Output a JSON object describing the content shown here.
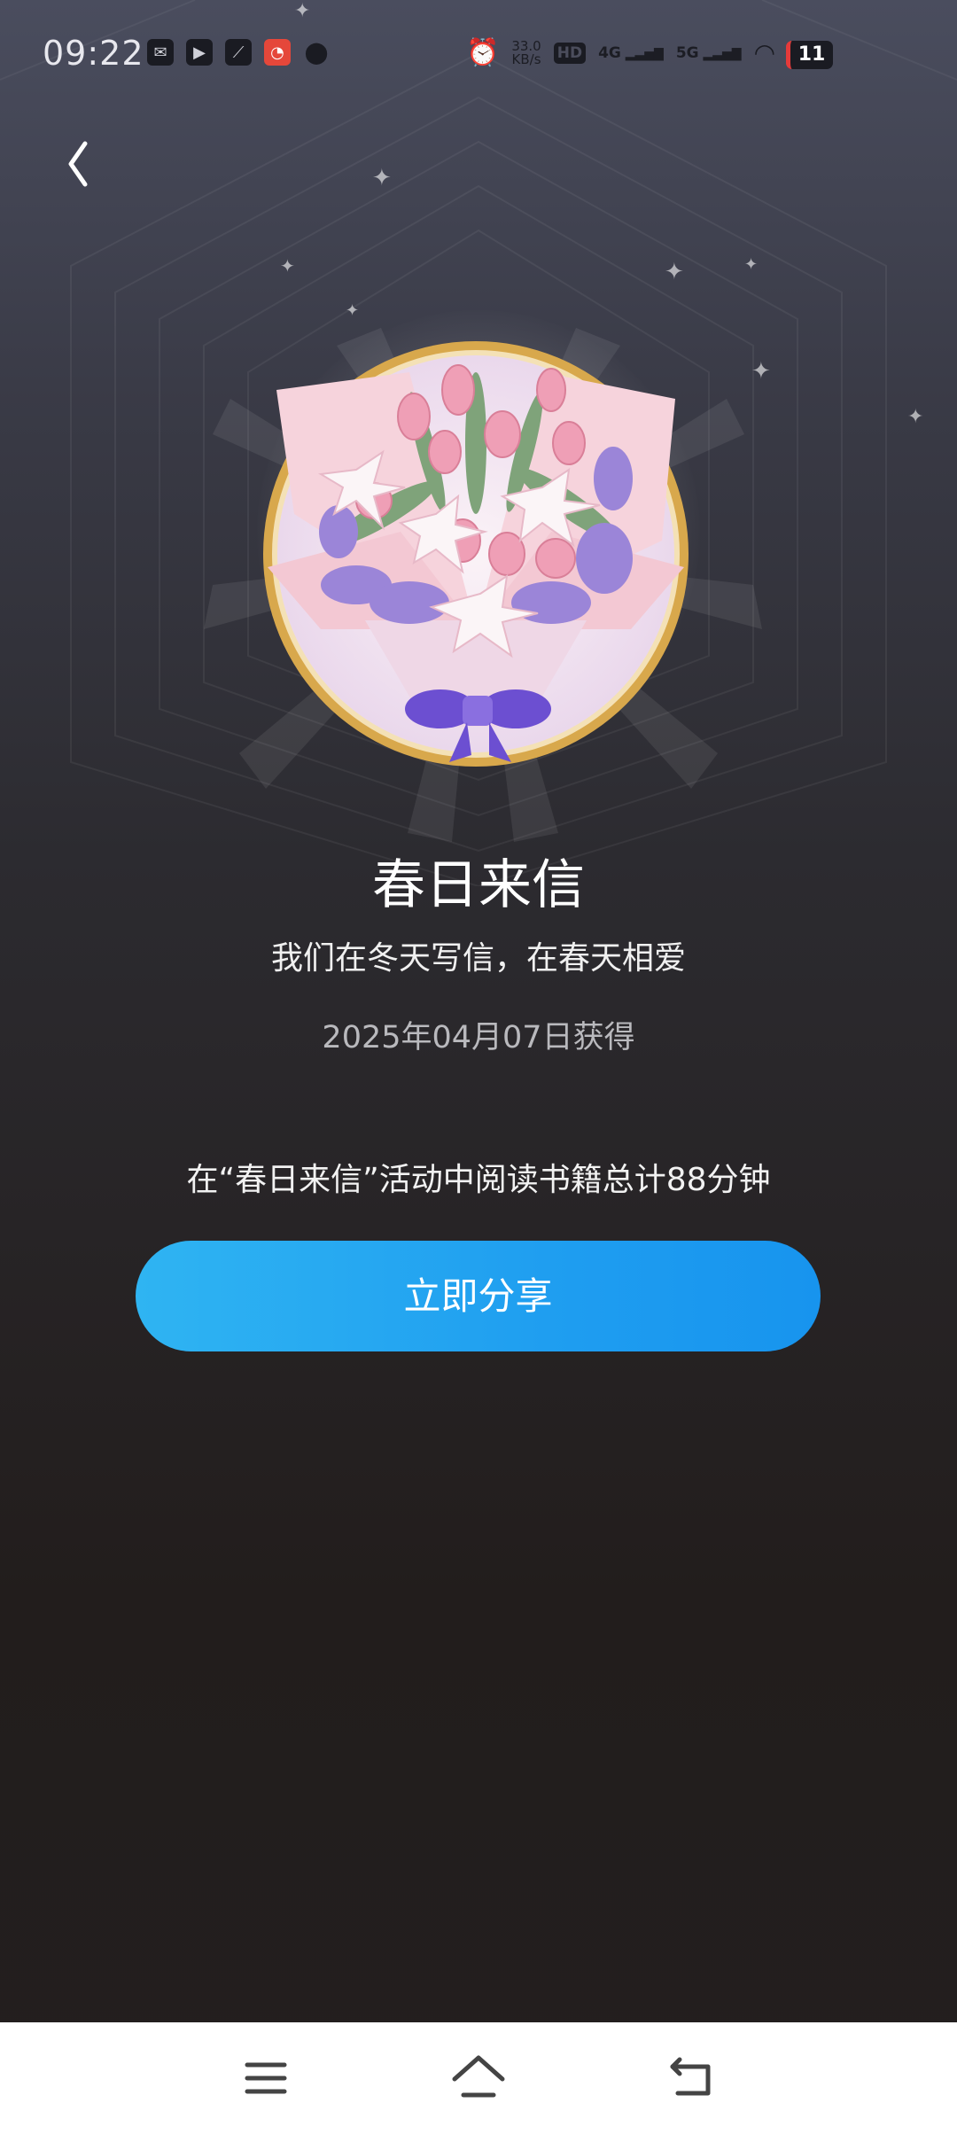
{
  "status_bar": {
    "time": "09:22",
    "speed_value": "33.0",
    "speed_unit": "KB/s",
    "hd_label": "HD",
    "net_4g": "4G",
    "net_5g": "5G",
    "battery_level": "11"
  },
  "award": {
    "title": "春日来信",
    "subtitle": "我们在冬天写信，在春天相爱",
    "date": "2025年04月07日获得",
    "description": "在“春日来信”活动中阅读书籍总计88分钟"
  },
  "actions": {
    "share_label": "立即分享"
  },
  "colors": {
    "share_button": "#1f9ef0",
    "medal_ring": "#d6a54a",
    "background_top": "#4a4d5e",
    "background_bottom": "#231f1f"
  },
  "icons": {
    "back": "chevron-left-icon",
    "nav_menu": "menu-icon",
    "nav_home": "home-icon",
    "nav_back": "return-icon"
  }
}
